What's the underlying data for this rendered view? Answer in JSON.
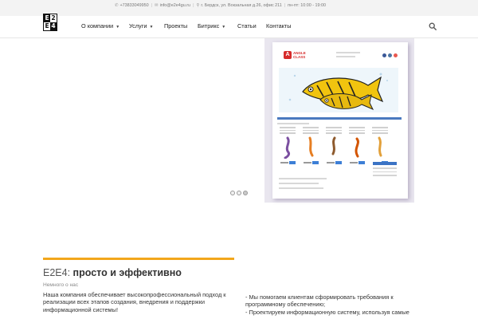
{
  "topbar": {
    "phone": "+73833049950",
    "email": "info@e2e4gu.ru",
    "address": "г. Бердск, ул. Вокзальная д.26, офис 211",
    "hours": "пн-пт: 10:00 - 19:00"
  },
  "logo": {
    "cells": [
      "E",
      "2",
      "E",
      "4"
    ]
  },
  "nav": {
    "items": [
      {
        "label": "О компании",
        "has_dropdown": true
      },
      {
        "label": "Услуги",
        "has_dropdown": true
      },
      {
        "label": "Проекты",
        "has_dropdown": false
      },
      {
        "label": "Битрикс",
        "has_dropdown": true
      },
      {
        "label": "Статьи",
        "has_dropdown": false
      },
      {
        "label": "Контакты",
        "has_dropdown": false
      }
    ],
    "search_icon": "search-icon"
  },
  "slider": {
    "slide_count": 3,
    "active_index": 2,
    "screenshot_logo": {
      "letter": "A",
      "line1": "ANGLE",
      "line2": "CLASS"
    }
  },
  "about": {
    "title_prefix": "E2E4:",
    "title_main": "просто и эффективно",
    "subtitle": "Немного о нас",
    "text": "Наша компания обеспечивает высокопрофессиональный подход к реализации всех этапов создания, внедрения и поддержки информационной системы!",
    "bullets": [
      "- Мы помогаем клиентам сформировать требования к программному обеспечению;",
      "- Проектируем информационную систему, используя самые"
    ]
  },
  "colors": {
    "accent": "#f2a71b",
    "topbar_bg": "#f3f3f3",
    "text": "#333333"
  }
}
